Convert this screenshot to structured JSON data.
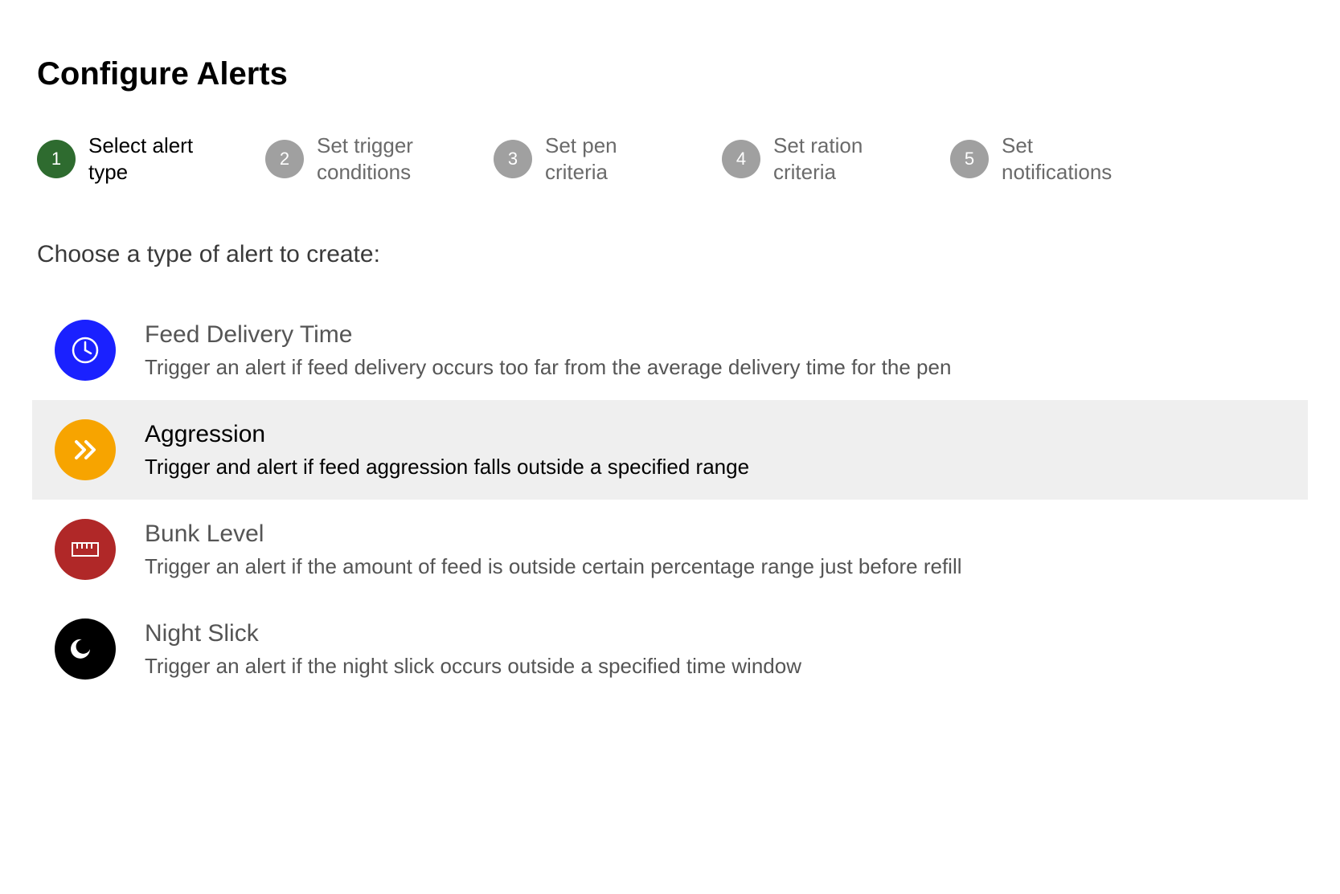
{
  "page_title": "Configure Alerts",
  "stepper": {
    "active_index": 0,
    "steps": [
      {
        "num": "1",
        "label": "Select alert type"
      },
      {
        "num": "2",
        "label": "Set trigger conditions"
      },
      {
        "num": "3",
        "label": "Set pen criteria"
      },
      {
        "num": "4",
        "label": "Set ration criteria"
      },
      {
        "num": "5",
        "label": "Set notifications"
      }
    ]
  },
  "prompt": "Choose a type of alert to create:",
  "options": {
    "selected_index": 1,
    "items": [
      {
        "key": "feed-delivery-time",
        "title": "Feed Delivery Time",
        "desc": "Trigger an alert if feed delivery occurs too far from the average delivery time for the pen",
        "icon": "clock-icon",
        "color": "#1a21ff"
      },
      {
        "key": "aggression",
        "title": "Aggression",
        "desc": "Trigger and alert if feed aggression falls outside a specified range",
        "icon": "chevrons-icon",
        "color": "#f7a400"
      },
      {
        "key": "bunk-level",
        "title": "Bunk Level",
        "desc": "Trigger an alert if the amount of feed is outside certain percentage range just before refill",
        "icon": "ruler-icon",
        "color": "#b02828"
      },
      {
        "key": "night-slick",
        "title": "Night Slick",
        "desc": "Trigger an alert if the night slick occurs outside a specified time window",
        "icon": "moon-icon",
        "color": "#000000"
      }
    ]
  }
}
